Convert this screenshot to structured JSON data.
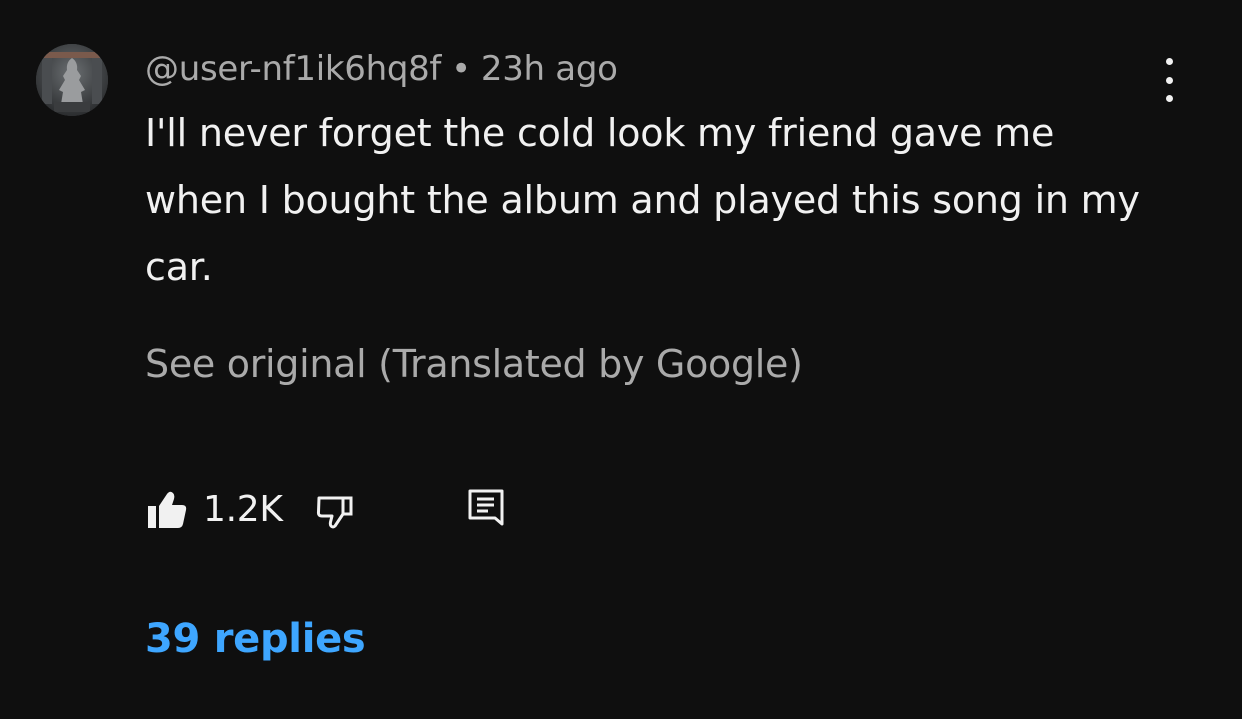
{
  "comment": {
    "author_handle": "@user-nf1ik6hq8f",
    "separator": "•",
    "timestamp": "23h ago",
    "text": "I'll never forget the cold look my friend gave me when I bought the album and played this song in my car.",
    "see_original_label": "See original (Translated by Google)",
    "like_count": "1.2K",
    "replies_label": "39 replies"
  },
  "icons": {
    "menu": "more-vert-icon",
    "like": "thumb-up-filled-icon",
    "dislike": "thumb-down-outline-icon",
    "reply": "comment-reply-icon"
  },
  "colors": {
    "background": "#0f0f0f",
    "primary_text": "#f1f1f1",
    "secondary_text": "#aaaaaa",
    "link": "#3ea6ff"
  }
}
